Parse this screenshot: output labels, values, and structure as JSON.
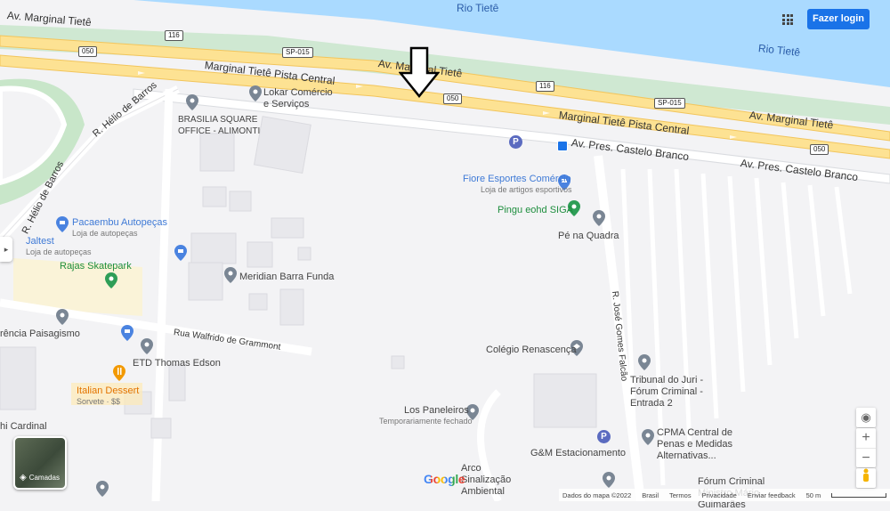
{
  "header": {
    "login_label": "Fazer login"
  },
  "water": {
    "label_top": "Rio Tietê",
    "label_right": "Rio Tietê"
  },
  "roads": {
    "marginal_tiete_left": "Av. Marginal Tietê",
    "marginal_pista_central_left": "Marginal Tietê Pista Central",
    "marginal_tiete_middle": "Av. Marginal Tietê",
    "marginal_pista_central_right": "Marginal Tietê Pista Central",
    "marginal_tiete_right": "Av. Marginal Tietê",
    "castelo_branco_1": "Av. Pres. Castelo Branco",
    "castelo_branco_2": "Av. Pres. Castelo Branco",
    "helio_de_barros_1": "R. Hélio de Barros",
    "helio_de_barros_2": "R. Hélio de Barros",
    "walfrido": "Rua Walfrido de Grammont",
    "jose_gomes": "R. José Gomes Falcão"
  },
  "shields": {
    "s116a": "116",
    "s050a": "050",
    "sp015a": "SP-015",
    "s050b": "050",
    "s116b": "116",
    "sp015b": "SP-015",
    "s050c": "050"
  },
  "places": {
    "lokar": {
      "name": "Lokar Comércio e Serviços"
    },
    "brasilia": {
      "name": "BRASILIA SQUARE OFFICE - ALIMONTI"
    },
    "fiore": {
      "name": "Fiore Esportes Comércio",
      "sub": "Loja de artigos esportivos"
    },
    "pingu": {
      "name": "Pingu eohd SIGA"
    },
    "pe_quadra": {
      "name": "Pé na Quadra"
    },
    "pacaembu": {
      "name": "Pacaembu Autopeças",
      "sub": "Loja de autopeças"
    },
    "jaltest": {
      "name": "Jaltest",
      "sub": "Loja de autopeças"
    },
    "rajas": {
      "name": "Rajas Skatepark"
    },
    "meridian": {
      "name": "Meridian Barra Funda"
    },
    "paisagismo": {
      "name": "rência Paisagismo"
    },
    "etd": {
      "name": "ETD Thomas Edson"
    },
    "italian": {
      "name": "Italian Dessert",
      "sub": "Sorvete · $$"
    },
    "cardinal": {
      "name": "hi Cardinal"
    },
    "renascenca": {
      "name": "Colégio Renascença"
    },
    "tribunal": {
      "name": "Tribunal do Juri - Fórum Criminal - Entrada 2"
    },
    "paneleiros": {
      "name": "Los Paneleiros",
      "sub": "Temporariamente fechado"
    },
    "cpma": {
      "name": "CPMA Central de Penas e Medidas Alternativas..."
    },
    "gm": {
      "name": "G&M Estacionamento"
    },
    "arco": {
      "name": "Arco Sinalização Ambiental"
    },
    "forum": {
      "name": "Fórum Criminal Ministro Mário Guimarães"
    }
  },
  "layers_label": "Camadas",
  "google_label": "Google",
  "footer": {
    "data": "Dados do mapa ©2022",
    "country": "Brasil",
    "terms": "Termos",
    "privacy": "Privacidade",
    "feedback": "Enviar feedback",
    "scale": "50 m"
  },
  "icons": [
    "apps-grid-icon",
    "my-location-icon",
    "zoom-in-icon",
    "zoom-out-icon",
    "pegman-icon",
    "layers-icon",
    "down-arrow-annotation-icon",
    "parking-icon",
    "bus-stop-icon",
    "restaurant-icon",
    "shop-icon",
    "school-icon"
  ],
  "colors": {
    "water": "#aadaff",
    "highway": "#fde293",
    "highway_edge": "#f2c55c",
    "park": "#c8e6c9",
    "land": "#f3f3f5",
    "button": "#1a73e8"
  }
}
